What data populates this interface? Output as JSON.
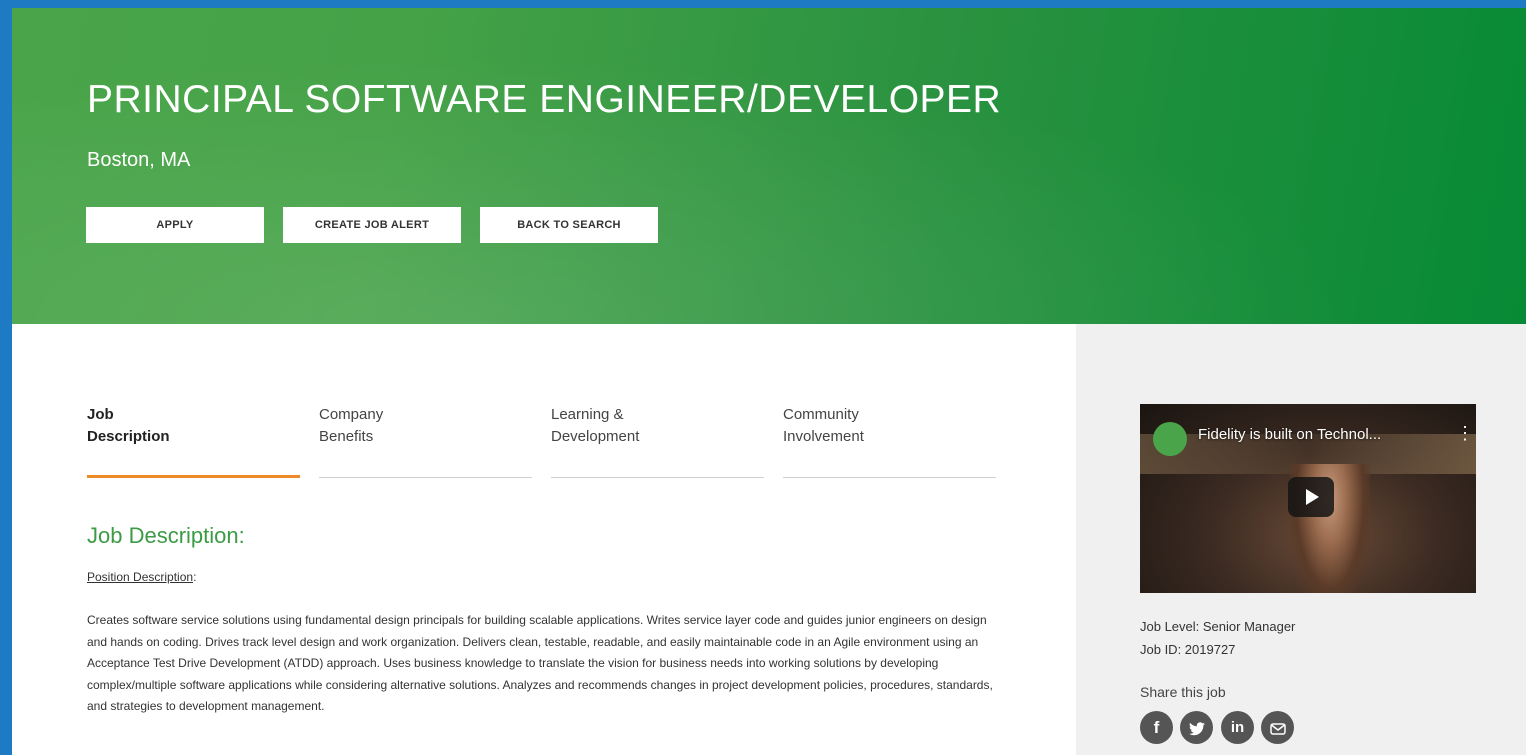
{
  "hero": {
    "title": "PRINCIPAL SOFTWARE ENGINEER/DEVELOPER",
    "location": "Boston, MA",
    "buttons": {
      "apply": "APPLY",
      "create_alert": "CREATE JOB ALERT",
      "back": "BACK TO SEARCH"
    }
  },
  "tabs": [
    {
      "line1": "Job",
      "line2": "Description",
      "active": true
    },
    {
      "line1": "Company",
      "line2": "Benefits",
      "active": false
    },
    {
      "line1": "Learning &",
      "line2": "Development",
      "active": false
    },
    {
      "line1": "Community",
      "line2": "Involvement",
      "active": false
    }
  ],
  "content": {
    "heading": "Job Description:",
    "position_label": "Position Description",
    "position_suffix": ":",
    "description": "Creates software service solutions using fundamental design principals for building scalable applications. Writes service layer code and guides junior engineers on design and hands on coding. Drives track level design and work organization. Delivers clean, testable, readable, and easily maintainable code in an Agile environment using an Acceptance Test Drive Development (ATDD) approach. Uses business knowledge to translate the vision for business needs into working solutions by developing complex/multiple software applications while considering alternative solutions. Analyzes and recommends changes in project development policies, procedures, standards, and strategies to development management."
  },
  "sidebar": {
    "video": {
      "title": "Fidelity is built on Technol...",
      "menu_icon": "more-vert-icon",
      "play_icon": "play-icon"
    },
    "job_level": "Job Level: Senior Manager",
    "job_id": "Job ID: 2019727",
    "share_label": "Share this job",
    "share_icons": [
      "facebook-icon",
      "twitter-icon",
      "linkedin-icon",
      "email-icon"
    ]
  },
  "colors": {
    "accent_orange": "#ef8a2a",
    "heading_green": "#3c9b45",
    "hero_green": "#2a9240"
  }
}
